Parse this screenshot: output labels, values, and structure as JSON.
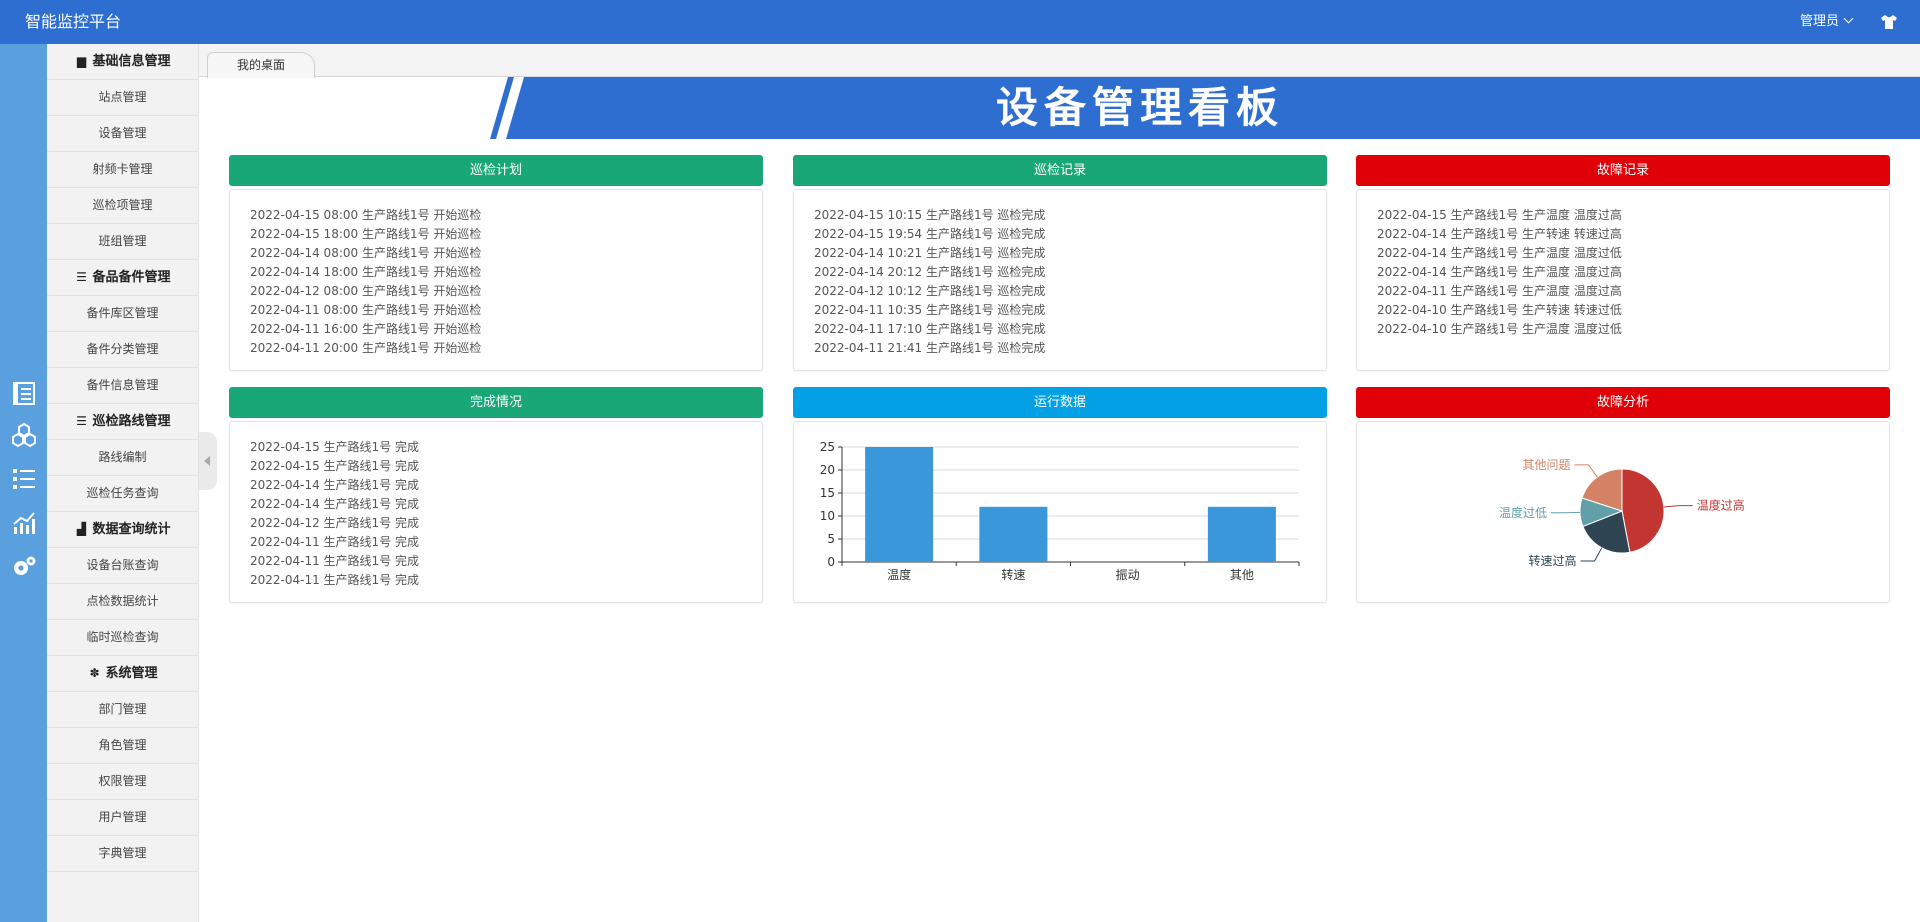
{
  "app": {
    "title": "智能监控平台",
    "user": "管理员",
    "skin_icon": "tshirt-icon"
  },
  "rail_icons": [
    "book-icon",
    "cubes-icon",
    "list-icon",
    "chart-line-icon",
    "gear-icon"
  ],
  "sidebar": {
    "groups": [
      {
        "title": "基础信息管理",
        "icon": "book-icon",
        "glyph": "▆",
        "items": [
          "站点管理",
          "设备管理",
          "射频卡管理",
          "巡检项管理",
          "班组管理"
        ]
      },
      {
        "title": "备品备件管理",
        "icon": "list-icon",
        "glyph": "☰",
        "items": [
          "备件库区管理",
          "备件分类管理",
          "备件信息管理"
        ]
      },
      {
        "title": "巡检路线管理",
        "icon": "list-icon",
        "glyph": "☰",
        "items": [
          "路线编制",
          "巡检任务查询"
        ]
      },
      {
        "title": "数据查询统计",
        "icon": "bar-chart-icon",
        "glyph": "▟",
        "items": [
          "设备台账查询",
          "点检数据统计",
          "临时巡检查询"
        ]
      },
      {
        "title": "系统管理",
        "icon": "gear-icon",
        "glyph": "✽",
        "items": [
          "部门管理",
          "角色管理",
          "权限管理",
          "用户管理",
          "字典管理"
        ]
      }
    ]
  },
  "tabs": [
    "我的桌面"
  ],
  "banner_title": "设备管理看板",
  "panels": {
    "plan": {
      "title": "巡检计划",
      "color": "#1aa778",
      "rows": [
        "2022-04-15 08:00 生产路线1号 开始巡检",
        "2022-04-15 18:00 生产路线1号 开始巡检",
        "2022-04-14 08:00 生产路线1号 开始巡检",
        "2022-04-14 18:00 生产路线1号 开始巡检",
        "2022-04-12 08:00 生产路线1号 开始巡检",
        "2022-04-11 08:00 生产路线1号 开始巡检",
        "2022-04-11 16:00 生产路线1号 开始巡检",
        "2022-04-11 20:00 生产路线1号 开始巡检"
      ]
    },
    "record": {
      "title": "巡检记录",
      "color": "#1aa778",
      "rows": [
        "2022-04-15 10:15 生产路线1号 巡检完成",
        "2022-04-15 19:54 生产路线1号 巡检完成",
        "2022-04-14 10:21 生产路线1号 巡检完成",
        "2022-04-14 20:12 生产路线1号 巡检完成",
        "2022-04-12 10:12 生产路线1号 巡检完成",
        "2022-04-11 10:35 生产路线1号 巡检完成",
        "2022-04-11 17:10 生产路线1号 巡检完成",
        "2022-04-11 21:41 生产路线1号 巡检完成"
      ]
    },
    "fault": {
      "title": "故障记录",
      "color": "#e00007",
      "rows": [
        "2022-04-15 生产路线1号 生产温度 温度过高",
        "2022-04-14 生产路线1号 生产转速 转速过高",
        "2022-04-14 生产路线1号 生产温度 温度过低",
        "2022-04-14 生产路线1号 生产温度 温度过高",
        "2022-04-11 生产路线1号 生产温度 温度过高",
        "2022-04-10 生产路线1号 生产转速 转速过低",
        "2022-04-10 生产路线1号 生产温度 温度过低"
      ]
    },
    "complete": {
      "title": "完成情况",
      "color": "#1aa778",
      "rows": [
        "2022-04-15 生产路线1号 完成",
        "2022-04-15 生产路线1号 完成",
        "2022-04-14 生产路线1号 完成",
        "2022-04-14 生产路线1号 完成",
        "2022-04-12 生产路线1号 完成",
        "2022-04-11 生产路线1号 完成",
        "2022-04-11 生产路线1号 完成",
        "2022-04-11 生产路线1号 完成"
      ]
    },
    "running": {
      "title": "运行数据",
      "color": "#03a0e6"
    },
    "analysis": {
      "title": "故障分析",
      "color": "#e00007"
    }
  },
  "chart_data": [
    {
      "type": "bar",
      "categories": [
        "温度",
        "转速",
        "振动",
        "其他"
      ],
      "values": [
        25,
        12,
        0,
        12
      ],
      "ylim": [
        0,
        25
      ],
      "yticks": [
        0,
        5,
        10,
        15,
        20,
        25
      ],
      "color": "#3a97da",
      "grid": true
    },
    {
      "type": "pie",
      "labels": [
        "温度过高",
        "转速过高",
        "温度过低",
        "其他问题"
      ],
      "values": [
        47,
        22,
        11,
        20
      ],
      "colors": [
        "#c23531",
        "#2f4554",
        "#61a0a8",
        "#d48265"
      ]
    }
  ]
}
